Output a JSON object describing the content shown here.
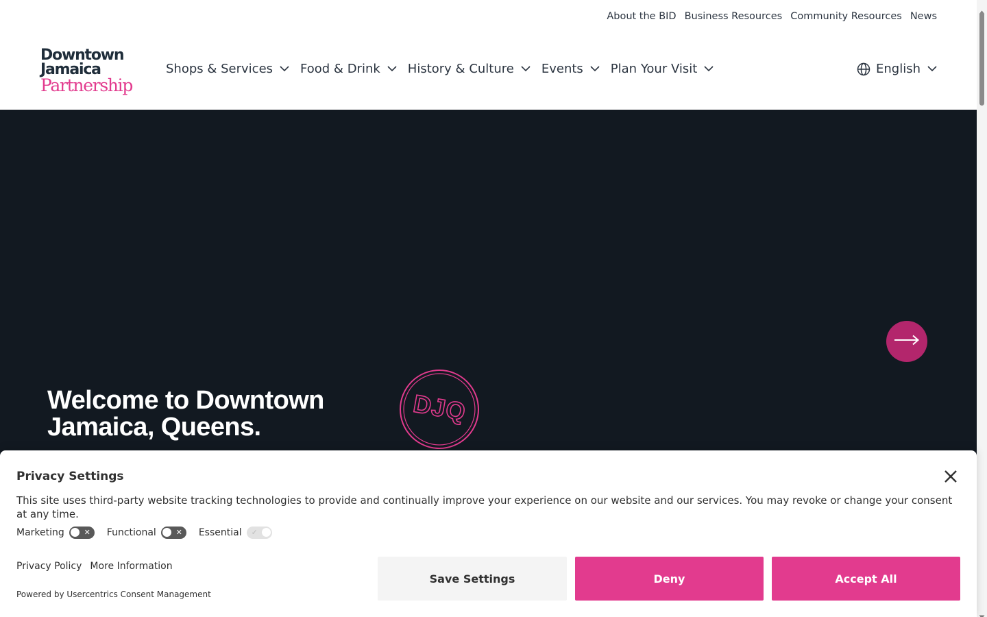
{
  "utility_nav": [
    "About the BID",
    "Business Resources",
    "Community Resources",
    "News"
  ],
  "logo": {
    "line1": "Downtown",
    "line2": "Jamaica",
    "line3": "Partnership"
  },
  "main_nav": [
    "Shops & Services",
    "Food & Drink",
    "History & Culture",
    "Events",
    "Plan Your Visit"
  ],
  "language": {
    "label": "English",
    "icon": "globe-icon"
  },
  "hero": {
    "title": "Welcome to Downtown Jamaica, Queens.",
    "badge_text": "DJQ",
    "next_icon": "arrow-right-icon"
  },
  "consent": {
    "title": "Privacy Settings",
    "text": "This site uses third-party website tracking technologies to provide and continually improve your experience on our website and our services. You may revoke or change your consent at any time.",
    "toggles": [
      {
        "label": "Marketing",
        "state": "off"
      },
      {
        "label": "Functional",
        "state": "off"
      },
      {
        "label": "Essential",
        "state": "on (disabled)"
      }
    ],
    "links": {
      "privacy_policy": "Privacy Policy",
      "more_info": "More Information"
    },
    "powered_by": "Powered by Usercentrics Consent Management",
    "buttons": {
      "save": "Save Settings",
      "deny": "Deny",
      "accept": "Accept All"
    }
  },
  "colors": {
    "brand_pink": "#e23b8e",
    "hero_bg": "#121921",
    "next_button": "#b3266c",
    "text_dark": "#2b3440"
  }
}
